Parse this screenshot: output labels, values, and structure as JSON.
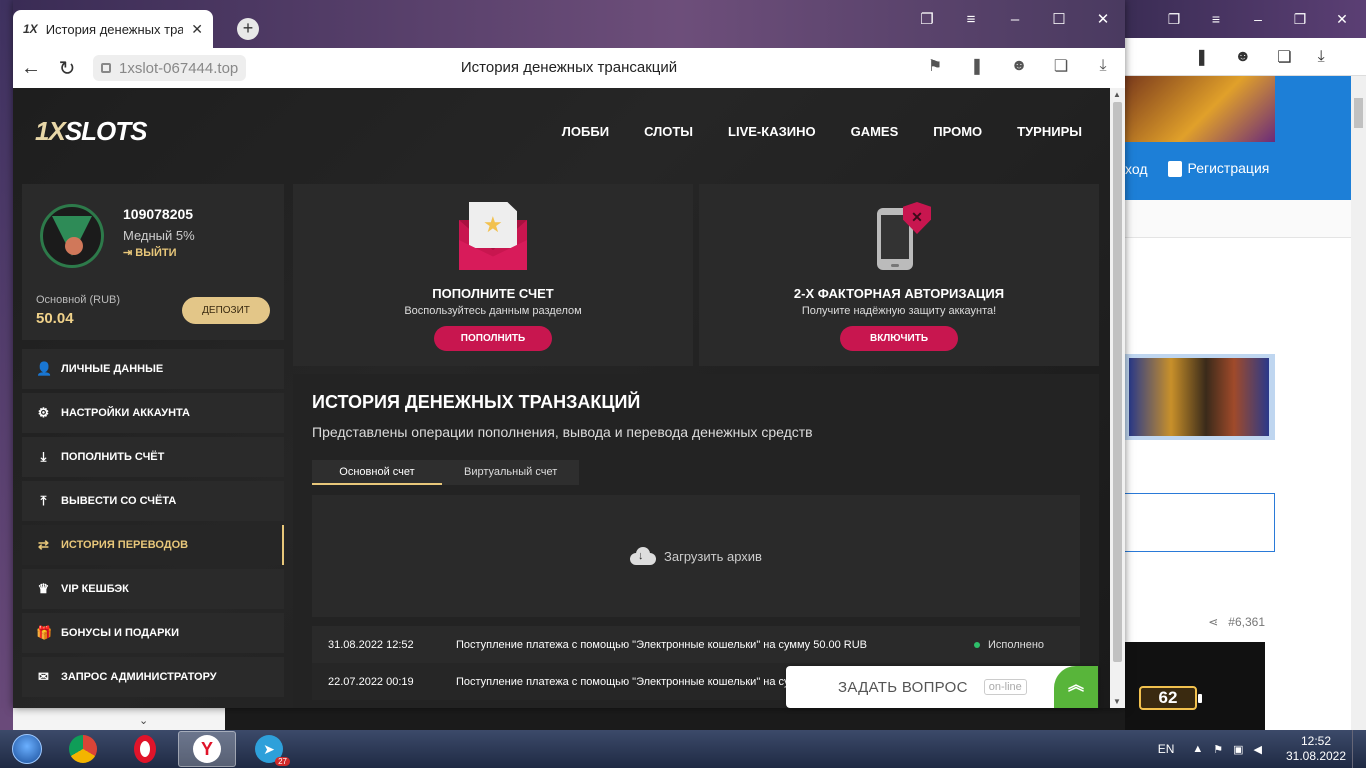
{
  "browser": {
    "tab_title": "История денежных трансакций",
    "tab_favicon": "1X",
    "url": "1xslot-067444.top",
    "page_title": "История денежных трансакций"
  },
  "site": {
    "logo": "SLOTS",
    "logo_prefix": "1X",
    "nav": [
      "ЛОББИ",
      "СЛОТЫ",
      "LIVE-КАЗИНО",
      "GAMES",
      "ПРОМО",
      "ТУРНИРЫ"
    ]
  },
  "profile": {
    "user_id": "109078205",
    "tier": "Медный 5%",
    "logout": "ВЫЙТИ",
    "balance_label": "Основной (RUB)",
    "balance": "50.04",
    "deposit_button": "ДЕПОЗИТ"
  },
  "menu": [
    {
      "label": "ЛИЧНЫЕ ДАННЫЕ",
      "icon": "user-plus-icon"
    },
    {
      "label": "НАСТРОЙКИ АККАУНТА",
      "icon": "gears-icon"
    },
    {
      "label": "ПОПОЛНИТЬ СЧЁТ",
      "icon": "download-icon"
    },
    {
      "label": "ВЫВЕСТИ СО СЧЁТА",
      "icon": "upload-icon"
    },
    {
      "label": "ИСТОРИЯ ПЕРЕВОДОВ",
      "icon": "transfer-arrows-icon"
    },
    {
      "label": "VIP КЕШБЭК",
      "icon": "crown-icon"
    },
    {
      "label": "БОНУСЫ И ПОДАРКИ",
      "icon": "gift-icon"
    },
    {
      "label": "ЗАПРОС АДМИНИСТРАТОРУ",
      "icon": "envelope-icon"
    }
  ],
  "promos": {
    "deposit": {
      "title": "ПОПОЛНИТЕ СЧЕТ",
      "subtitle": "Воспользуйтесь данным разделом",
      "button": "ПОПОЛНИТЬ"
    },
    "twofa": {
      "title": "2-Х ФАКТОРНАЯ АВТОРИЗАЦИЯ",
      "subtitle": "Получите надёжную защиту аккаунта!",
      "button": "ВКЛЮЧИТЬ"
    }
  },
  "history": {
    "title": "ИСТОРИЯ ДЕНЕЖНЫХ ТРАНЗАКЦИЙ",
    "description": "Представлены операции пополнения, вывода и перевода денежных средств",
    "tabs": [
      "Основной счет",
      "Виртуальный счет"
    ],
    "archive": "Загрузить архив",
    "rows": [
      {
        "date": "31.08.2022 12:52",
        "desc": "Поступление платежа с помощью \"Электронные кошельки\" на сумму 50.00 RUB",
        "status": "Исполнено"
      },
      {
        "date": "22.07.2022 00:19",
        "desc": "Поступление платежа с помощью \"Электронные кошельки\" на сумму 50.00 RUB",
        "status": ""
      }
    ]
  },
  "chat": {
    "label": "ЗАДАТЬ ВОПРОС",
    "badge": "on-line"
  },
  "background_window": {
    "login_partial": "ход",
    "register": "Регистрация",
    "counter": "#6,361",
    "battery": "62"
  },
  "taskbar": {
    "telegram_badge": "27",
    "lang": "EN",
    "time": "12:52",
    "date": "31.08.2022"
  },
  "colors": {
    "accent_gold": "#e8c77a",
    "accent_pink": "#c8164f",
    "success": "#2ebf6a"
  }
}
